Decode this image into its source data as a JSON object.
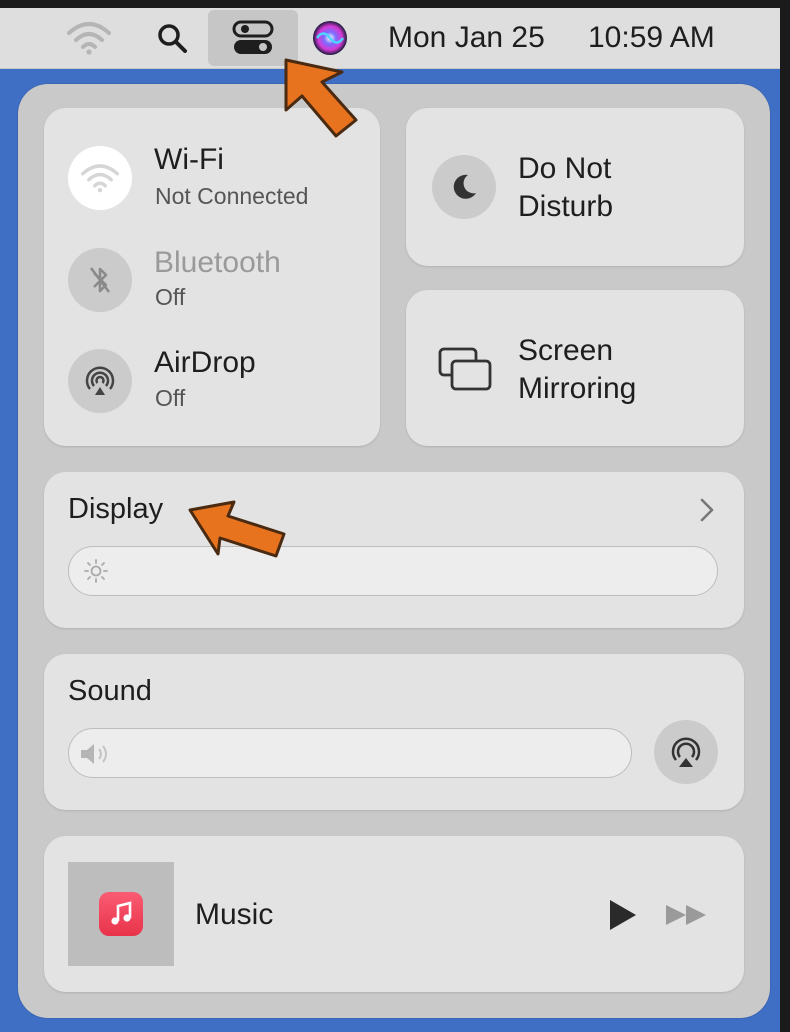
{
  "menubar": {
    "date": "Mon Jan 25",
    "time": "10:59 AM",
    "icons": [
      "wifi-icon",
      "search-icon",
      "control-center-icon",
      "siri-icon"
    ]
  },
  "connectivity": {
    "wifi": {
      "title": "Wi-Fi",
      "status": "Not Connected"
    },
    "bluetooth": {
      "title": "Bluetooth",
      "status": "Off"
    },
    "airdrop": {
      "title": "AirDrop",
      "status": "Off"
    }
  },
  "do_not_disturb": {
    "line1": "Do Not",
    "line2": "Disturb"
  },
  "screen_mirroring": {
    "line1": "Screen",
    "line2": "Mirroring"
  },
  "display": {
    "title": "Display",
    "brightness": 0.0
  },
  "sound": {
    "title": "Sound",
    "volume": 0.0
  },
  "music": {
    "title": "Music"
  },
  "colors": {
    "accent_arrow": "#e8731f",
    "desktop": "#3f6fc4",
    "panel": "#c9c9c9",
    "tile": "#e3e3e3"
  }
}
